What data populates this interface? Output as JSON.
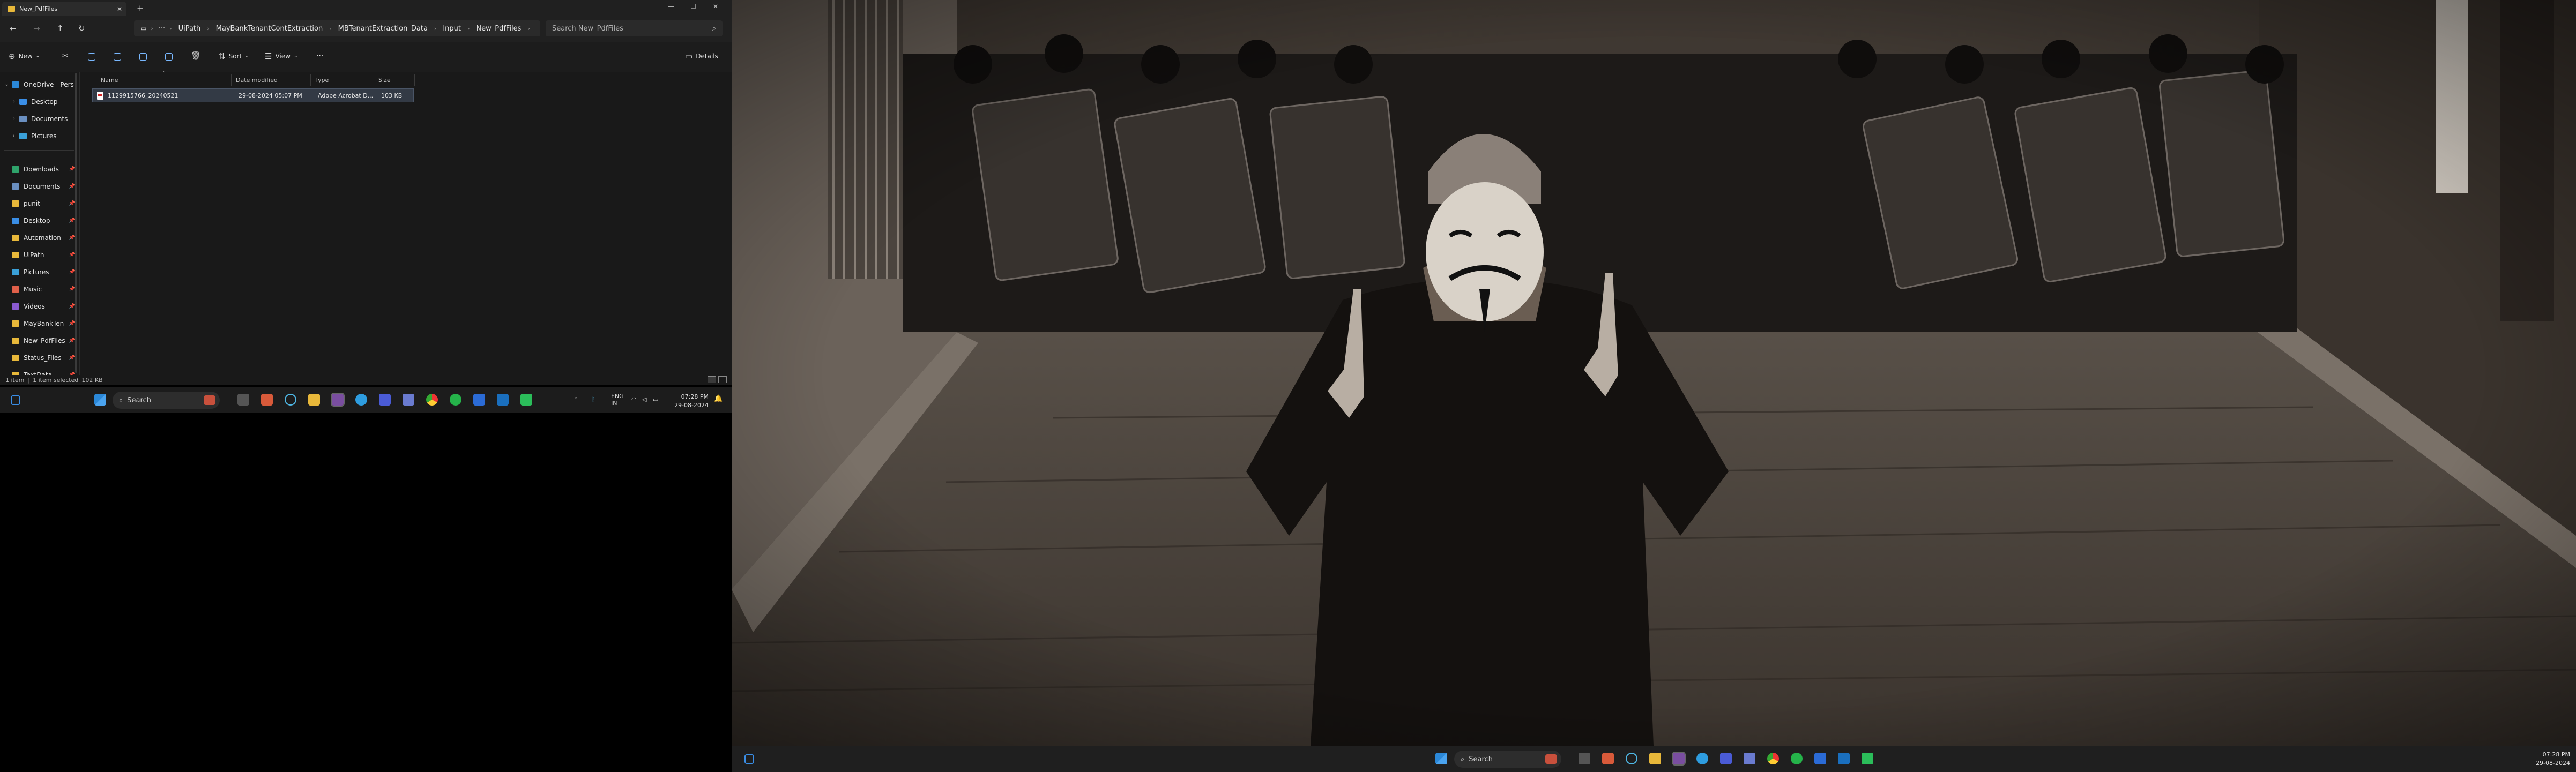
{
  "explorer": {
    "tab_title": "New_PdfFiles",
    "breadcrumbs": [
      "UiPath",
      "MayBankTenantContExtraction",
      "MBTenantExtraction_Data",
      "Input",
      "New_PdfFiles"
    ],
    "search_placeholder": "Search New_PdfFiles",
    "toolbar": {
      "new_label": "New",
      "sort_label": "Sort",
      "view_label": "View",
      "more_label": "···",
      "details_label": "Details"
    },
    "nav": [
      {
        "label": "OneDrive - Pers",
        "icon": "onedrive-icon",
        "expanded": true,
        "pinned": false
      },
      {
        "label": "Desktop",
        "icon": "desktop-folder-icon",
        "expanded": false,
        "pinned": false
      },
      {
        "label": "Documents",
        "icon": "documents-folder-icon",
        "expanded": false,
        "pinned": false
      },
      {
        "label": "Pictures",
        "icon": "pictures-folder-icon",
        "expanded": false,
        "pinned": false
      },
      {
        "label": "Downloads",
        "icon": "downloads-icon",
        "expanded": false,
        "pinned": true
      },
      {
        "label": "Documents",
        "icon": "documents-icon",
        "expanded": false,
        "pinned": true
      },
      {
        "label": "punit",
        "icon": "folder-icon",
        "expanded": false,
        "pinned": true
      },
      {
        "label": "Desktop",
        "icon": "desktop-icon",
        "expanded": false,
        "pinned": true
      },
      {
        "label": "Automation",
        "icon": "folder-icon",
        "expanded": false,
        "pinned": true
      },
      {
        "label": "UiPath",
        "icon": "folder-icon",
        "expanded": false,
        "pinned": true
      },
      {
        "label": "Pictures",
        "icon": "pictures-icon",
        "expanded": false,
        "pinned": true
      },
      {
        "label": "Music",
        "icon": "music-icon",
        "expanded": false,
        "pinned": true
      },
      {
        "label": "Videos",
        "icon": "videos-icon",
        "expanded": false,
        "pinned": true
      },
      {
        "label": "MayBankTen",
        "icon": "folder-icon",
        "expanded": false,
        "pinned": true
      },
      {
        "label": "New_PdfFiles",
        "icon": "folder-icon",
        "expanded": false,
        "pinned": true
      },
      {
        "label": "Status_Files",
        "icon": "folder-icon",
        "expanded": false,
        "pinned": true
      },
      {
        "label": "TextData",
        "icon": "folder-icon",
        "expanded": false,
        "pinned": true
      }
    ],
    "columns": [
      "Name",
      "Date modified",
      "Type",
      "Size"
    ],
    "files": [
      {
        "name": "1129915766_20240521",
        "date": "29-08-2024 05:07 PM",
        "type": "Adobe Acrobat D...",
        "size": "103 KB"
      }
    ],
    "status": {
      "count": "1 item",
      "selected": "1 item selected",
      "size": "102 KB"
    }
  },
  "taskbar": {
    "search_label": "Search",
    "language": "ENG",
    "region": "IN",
    "time": "07:28 PM",
    "date": "29-08-2024"
  },
  "colors": {
    "explorer_bg": "#191919",
    "selection": "#333a45",
    "accent": "#79b8ff",
    "folder": "#e8b83a"
  },
  "wallpaper_description_icon": "anonymous-mask-wallpaper"
}
